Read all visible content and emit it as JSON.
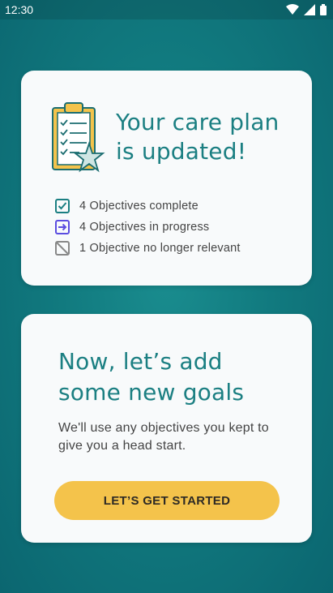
{
  "status_bar": {
    "time": "12:30",
    "icons": [
      "wifi-icon",
      "signal-icon",
      "battery-icon"
    ]
  },
  "update_card": {
    "title": "Your care plan is updated!",
    "items": [
      {
        "icon": "checked-box-icon",
        "label": "4 Objectives complete",
        "color": "#1b7f82"
      },
      {
        "icon": "arrow-box-icon",
        "label": "4 Objectives in progress",
        "color": "#5b4de0"
      },
      {
        "icon": "crossed-box-icon",
        "label": "1 Objective no longer relevant",
        "color": "#888888"
      }
    ]
  },
  "goals_card": {
    "title": "Now, let’s add some new goals",
    "description": "We'll use any objectives you kept to give you a head start.",
    "cta_label": "LET’S GET STARTED"
  },
  "colors": {
    "background": "#127d82",
    "accent": "#1b7f82",
    "cta": "#f4c34b",
    "card": "#f8fafb"
  }
}
